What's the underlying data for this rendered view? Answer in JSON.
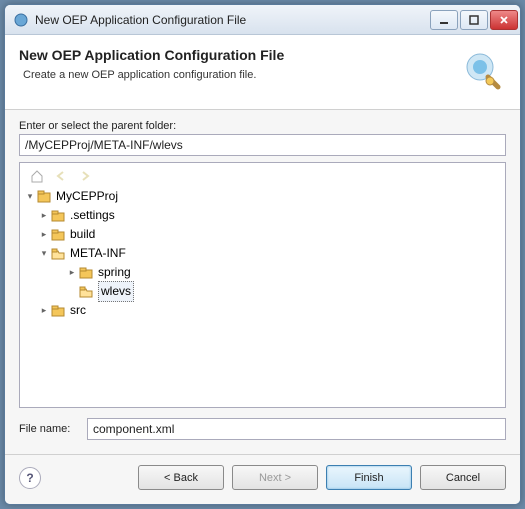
{
  "window": {
    "title": "New OEP Application Configuration File"
  },
  "header": {
    "title": "New OEP Application Configuration File",
    "description": "Create a new OEP application configuration file."
  },
  "form": {
    "parent_folder_label": "Enter or select the parent folder:",
    "parent_folder_value": "/MyCEPProj/META-INF/wlevs",
    "filename_label": "File name:",
    "filename_value": "component.xml"
  },
  "tree": {
    "root": "MyCEPProj",
    "children": [
      {
        "label": ".settings",
        "icon": "folder"
      },
      {
        "label": "build",
        "icon": "folder"
      },
      {
        "label": "META-INF",
        "icon": "folder-open",
        "children": [
          {
            "label": "spring",
            "icon": "folder"
          },
          {
            "label": "wlevs",
            "icon": "folder-open",
            "selected": true
          }
        ]
      },
      {
        "label": "src",
        "icon": "folder"
      }
    ]
  },
  "buttons": {
    "back": "< Back",
    "next": "Next >",
    "finish": "Finish",
    "cancel": "Cancel"
  },
  "colors": {
    "accent": "#3c7fb1",
    "folder": "#f4c65a"
  }
}
